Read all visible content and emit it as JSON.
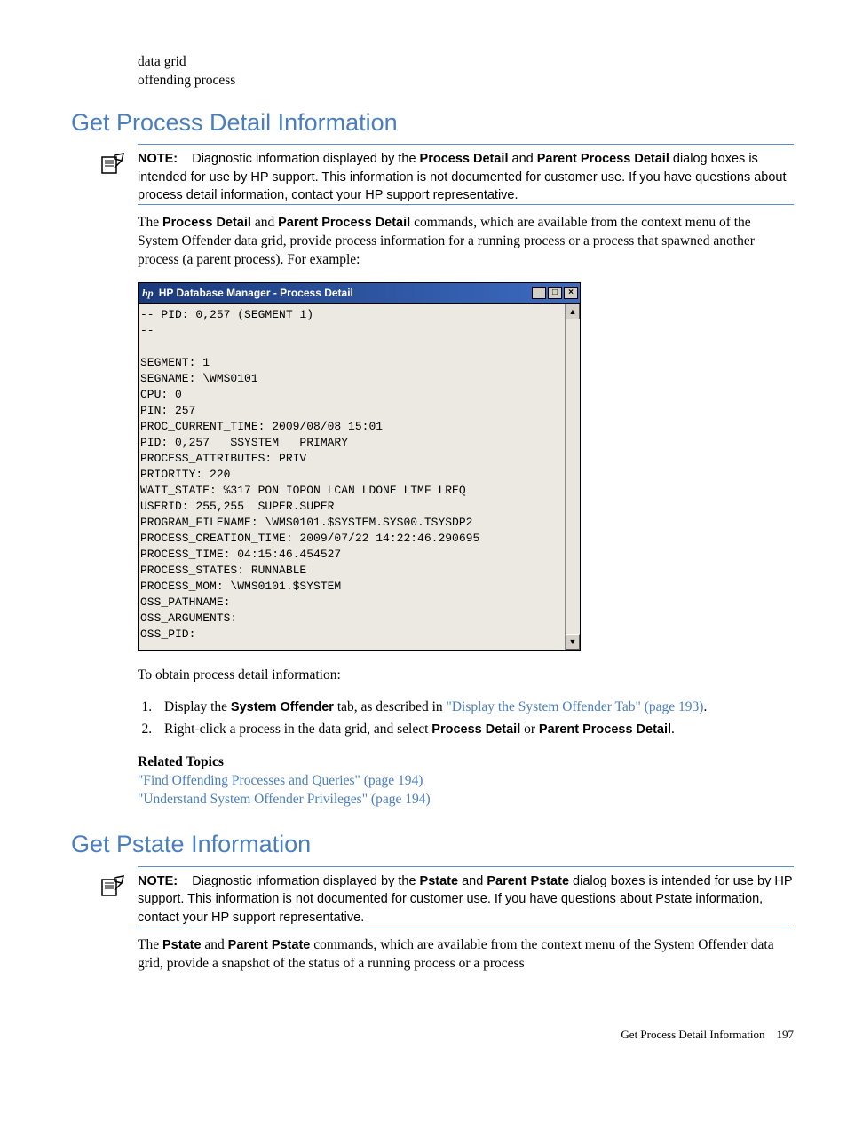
{
  "top_fragments": {
    "line1": "data grid",
    "line2": "offending process"
  },
  "section1": {
    "heading": "Get Process Detail Information",
    "note_label": "NOTE:",
    "note_body_pre": "Diagnostic information displayed by the ",
    "note_bold1": "Process Detail",
    "note_mid1": " and ",
    "note_bold2": "Parent Process Detail",
    "note_body_post": " dialog boxes is intended for use by HP support. This information is not documented for customer use. If you have questions about process detail information, contact your HP support representative.",
    "para_pre": "The ",
    "para_b1": "Process Detail",
    "para_mid1": " and ",
    "para_b2": "Parent Process Detail",
    "para_post": " commands, which are available from the context menu of the System Offender data grid, provide process information for a running process or a process that spawned another process (a parent process). For example:"
  },
  "dialog": {
    "logo": "hp",
    "title": "HP Database Manager - Process Detail",
    "content": "-- PID: 0,257 (SEGMENT 1)\n--\n\nSEGMENT: 1\nSEGNAME: \\WMS0101\nCPU: 0\nPIN: 257\nPROC_CURRENT_TIME: 2009/08/08 15:01\nPID: 0,257   $SYSTEM   PRIMARY\nPROCESS_ATTRIBUTES: PRIV\nPRIORITY: 220\nWAIT_STATE: %317 PON IOPON LCAN LDONE LTMF LREQ\nUSERID: 255,255  SUPER.SUPER\nPROGRAM_FILENAME: \\WMS0101.$SYSTEM.SYS00.TSYSDP2\nPROCESS_CREATION_TIME: 2009/07/22 14:22:46.290695\nPROCESS_TIME: 04:15:46.454527\nPROCESS_STATES: RUNNABLE\nPROCESS_MOM: \\WMS0101.$SYSTEM\nOSS_PATHNAME:\nOSS_ARGUMENTS:\nOSS_PID:"
  },
  "obtain_intro": "To obtain process detail information:",
  "steps": {
    "s1_pre": "Display the ",
    "s1_bold": "System Offender",
    "s1_mid": " tab, as described in ",
    "s1_link": "\"Display the System Offender Tab\" (page 193)",
    "s1_post": ".",
    "s2_pre": "Right-click a process in the data grid, and select ",
    "s2_b1": "Process Detail",
    "s2_mid": " or ",
    "s2_b2": "Parent Process Detail",
    "s2_post": "."
  },
  "related": {
    "heading": "Related Topics",
    "link1": "\"Find Offending Processes and Queries\" (page 194)",
    "link2": "\"Understand System Offender Privileges\" (page 194)"
  },
  "section2": {
    "heading": "Get Pstate Information",
    "note_label": "NOTE:",
    "note_pre": "Diagnostic information displayed by the ",
    "note_b1": "Pstate",
    "note_mid1": " and ",
    "note_b2": "Parent Pstate",
    "note_post": " dialog boxes is intended for use by HP support. This information is not documented for customer use. If you have questions about Pstate information, contact your HP support representative.",
    "para_pre": "The ",
    "para_b1": "Pstate",
    "para_mid": " and ",
    "para_b2": "Parent Pstate",
    "para_post": " commands, which are available from the context menu of the System Offender data grid, provide a snapshot of the status of a running process or a process"
  },
  "footer": {
    "text": "Get Process Detail Information",
    "page": "197"
  }
}
